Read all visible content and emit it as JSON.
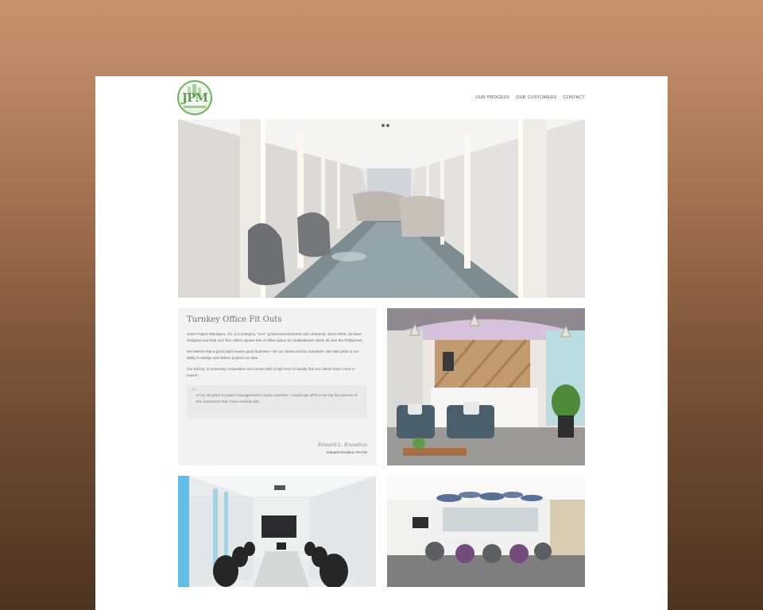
{
  "header": {
    "logo_text": "JPM",
    "nav": [
      "OUR PROCESS",
      "OUR CUSTOMERS",
      "CONTACT"
    ]
  },
  "intro": {
    "title": "Turnkey Office Fit Outs",
    "paragraphs": [
      "Jonie Project Managers, Inc. is a Category \"AAA\" government-licensed civil contractor. Since 2006, we have designed and built over five million square feet of office space for multinational clients all over the Philippines.",
      "We believe that a good build means good business—for our clients and for ourselves. We take pride in our ability to design and deliver projects on time.",
      "Our pricing, is extremely competitive and comes with a high level of quality that our clients have come to expect."
    ],
    "quote": "In my 25 years in project management in many countries, I would rate JPM in the top five percent of the contractors that I have worked with.",
    "quote_mark": "“",
    "signature": "Edward L. Knowlton",
    "author": "Edward Knowlton PCCW"
  },
  "colors": {
    "brand_green": "#5aa34c",
    "panel_bg": "#f2f2f2",
    "background_top": "#c89470",
    "background_bottom": "#4c3322"
  }
}
